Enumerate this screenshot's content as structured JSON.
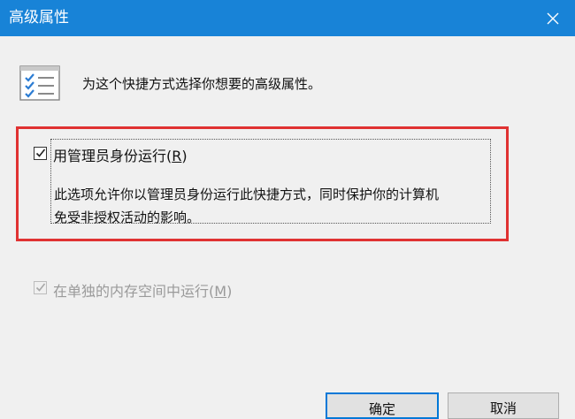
{
  "window": {
    "title": "高级属性"
  },
  "header": {
    "description": "为这个快捷方式选择你想要的高级属性。"
  },
  "options": {
    "run_as_admin": {
      "label_before": "用管理员身份运行(",
      "access_key": "R",
      "label_after": ")",
      "checked": true,
      "description_line1": "此选项允许你以管理员身份运行此快捷方式，同时保护你的计算机",
      "description_line2": "免受非授权活动的影响。"
    },
    "separate_memory": {
      "label_before": "在单独的内存空间中运行(",
      "access_key": "M",
      "label_after": ")",
      "checked": true,
      "enabled": false
    }
  },
  "buttons": {
    "ok": "确定",
    "cancel": "取消"
  },
  "colors": {
    "titlebar": "#1883d7",
    "highlight_border": "#e03232",
    "default_button_border": "#0078d7"
  },
  "icons": [
    "close-icon",
    "checklist-icon",
    "checkmark-icon"
  ]
}
